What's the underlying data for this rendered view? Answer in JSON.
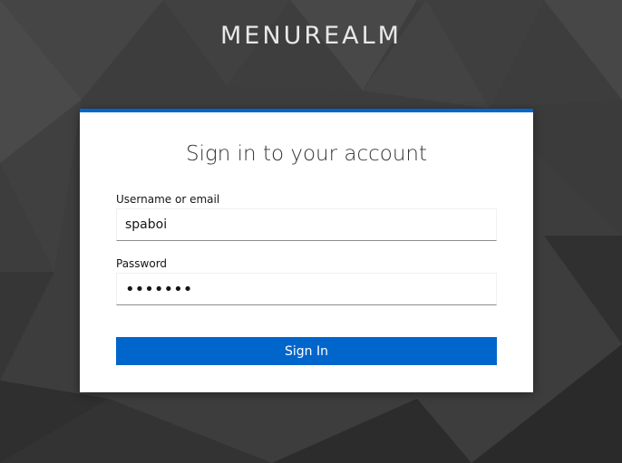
{
  "header": {
    "realm_name": "MENUREALM"
  },
  "login_form": {
    "title": "Sign in to your account",
    "username": {
      "label": "Username or email",
      "value": "spaboi"
    },
    "password": {
      "label": "Password",
      "value": "•••••••"
    },
    "submit_label": "Sign In"
  },
  "colors": {
    "background": "#3a3a3a",
    "accent": "#0066cc",
    "card": "#ffffff"
  }
}
